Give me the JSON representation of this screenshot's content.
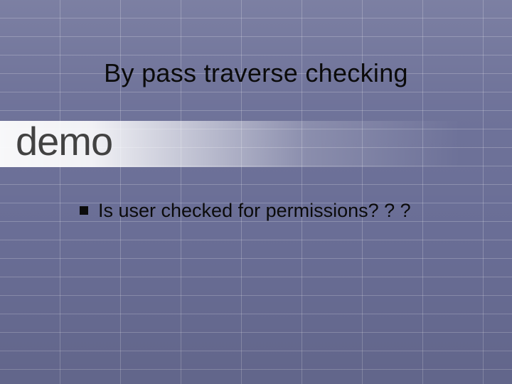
{
  "title": "By pass traverse checking",
  "demo_label": "demo",
  "bullets": [
    {
      "text": "Is user checked for permissions? ? ?"
    }
  ]
}
